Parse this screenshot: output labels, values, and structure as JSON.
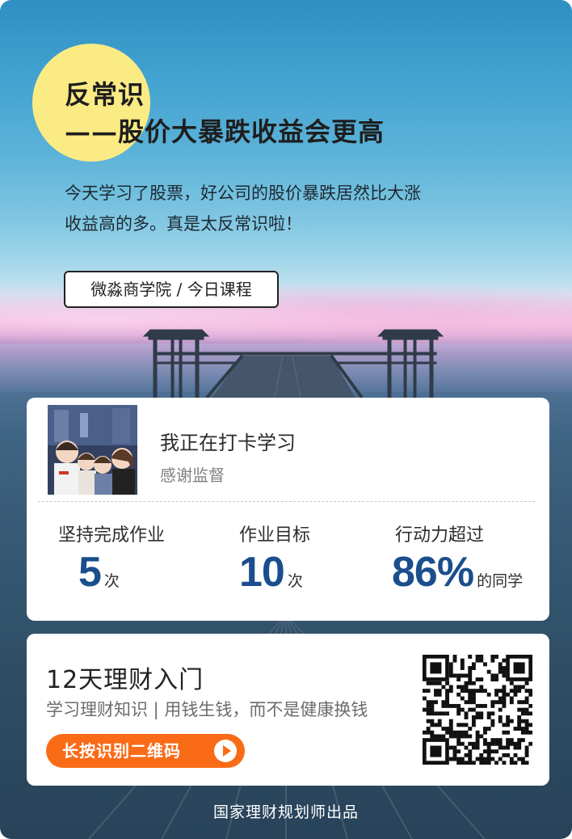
{
  "colors": {
    "highlight_circle": "#fbeb84",
    "accent_blue": "#1a4e8c",
    "cta_orange": "#fa6b17"
  },
  "header": {
    "title_line1": "反常识",
    "title_line2": "——股价大暴跌收益会更高",
    "intro_line1": "今天学习了股票，好公司的股价暴跌居然比大涨",
    "intro_line2": "收益高的多。真是太反常识啦！",
    "tag": "微淼商学院 / 今日课程"
  },
  "checkin": {
    "title": "我正在打卡学习",
    "subtitle": "感谢监督",
    "avatar_icon": "family-cartoon-avatar"
  },
  "stats": [
    {
      "label": "坚持完成作业",
      "value": "5",
      "unit": "次"
    },
    {
      "label": "作业目标",
      "value": "10",
      "unit": "次"
    },
    {
      "label": "行动力超过",
      "value": "86%",
      "unit": "的同学"
    }
  ],
  "course": {
    "title": "12天理财入门",
    "subtitle": "学习理财知识 | 用钱生钱，而不是健康换钱",
    "cta_label": "长按识别二维码",
    "cta_icon": "play-arrow-icon",
    "qr_icon": "qr-code"
  },
  "footer": {
    "text": "国家理财规划师出品"
  }
}
